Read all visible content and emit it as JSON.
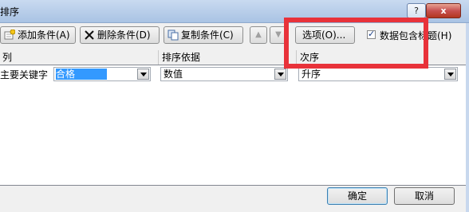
{
  "window": {
    "title": "排序",
    "help_button": "?",
    "close_button": "x"
  },
  "toolbar": {
    "add_condition": "添加条件(A)",
    "delete_condition": "删除条件(D)",
    "copy_condition": "复制条件(C)",
    "move_up": "▲",
    "move_down": "▼",
    "options": "选项(O)...",
    "header_checkbox_label": "数据包含标题(H)",
    "header_checkbox_checked": true
  },
  "columns": {
    "col": "列",
    "sort_on": "排序依据",
    "order": "次序"
  },
  "rows": [
    {
      "label": "主要关键字",
      "column_value": "合格",
      "sort_on_value": "数值",
      "order_value": "升序"
    }
  ],
  "buttons": {
    "ok": "确定",
    "cancel": "取消"
  },
  "colors": {
    "highlight_box": "#e8323a",
    "selection": "#3399ff"
  }
}
